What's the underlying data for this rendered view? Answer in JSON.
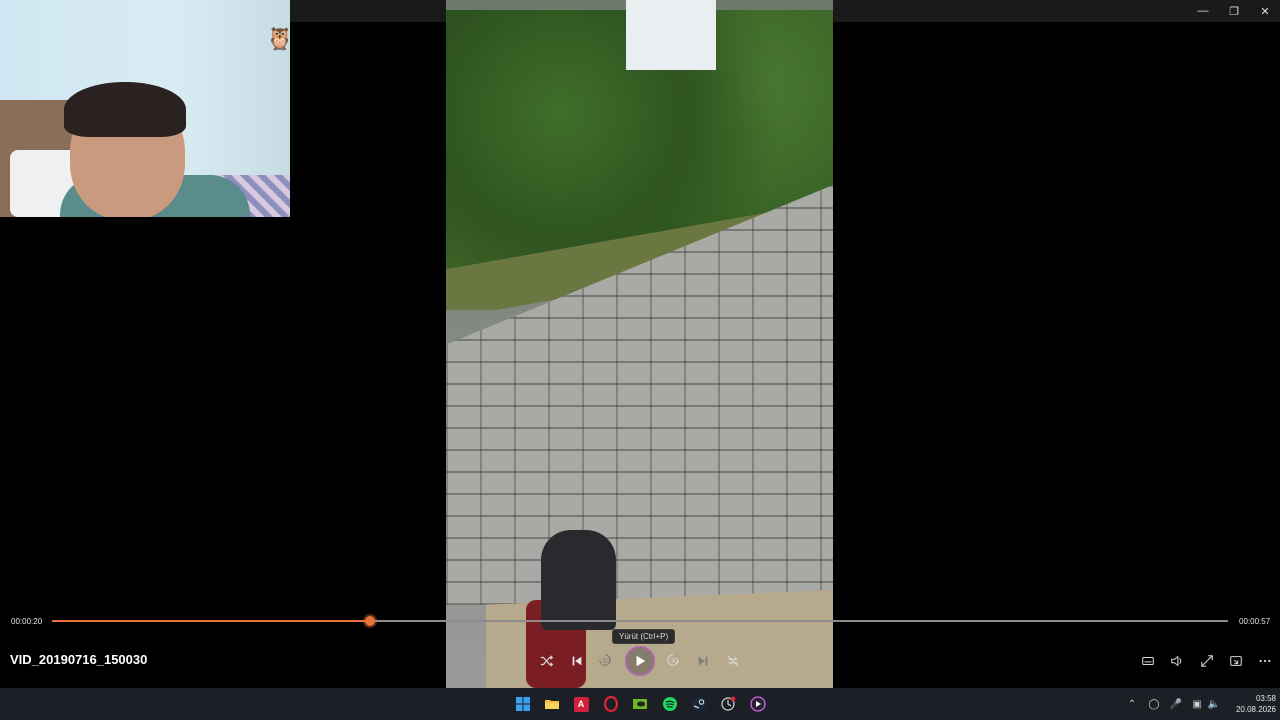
{
  "window": {
    "minimize_icon": "minimize-icon",
    "restore_icon": "restore-icon",
    "close_icon": "close-icon"
  },
  "video": {
    "filename": "VID_20190716_150030",
    "current_time": "00:00:20",
    "duration": "00:00:57",
    "progress_fraction": 0.27
  },
  "controls": {
    "shuffle_icon": "shuffle-icon",
    "previous_icon": "previous-icon",
    "skip_back_label": "10",
    "play_icon": "play-icon",
    "play_tooltip": "Yürüt (Ctrl+P)",
    "skip_forward_label": "30",
    "next_icon": "next-icon",
    "repeat_icon": "repeat-off-icon",
    "captions_icon": "captions-icon",
    "volume_icon": "volume-icon",
    "fullscreen_icon": "fullscreen-icon",
    "miniplayer_icon": "miniplayer-icon",
    "more_icon": "more-icon",
    "accent_color": "#e8743b"
  },
  "taskbar": {
    "apps": [
      "start",
      "file-explorer",
      "adobe-app",
      "opera-gx",
      "nvidia",
      "spotify",
      "steam",
      "clock-app",
      "media-player"
    ],
    "acrobat_letter": "A",
    "clock_time": "03:58",
    "clock_date": "20.08.2026"
  }
}
